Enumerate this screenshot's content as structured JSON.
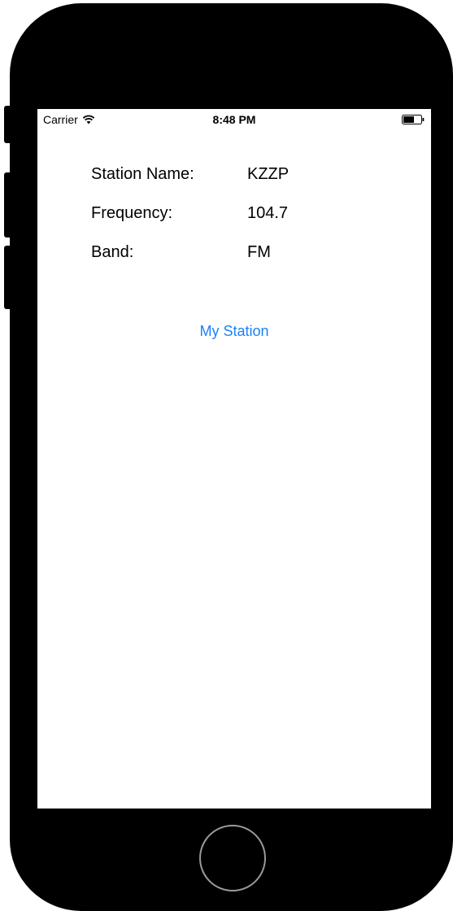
{
  "status_bar": {
    "carrier": "Carrier",
    "time": "8:48 PM",
    "wifi_icon": "wifi-icon",
    "battery_icon": "battery-icon"
  },
  "station": {
    "name_label": "Station Name:",
    "name_value": "KZZP",
    "frequency_label": "Frequency:",
    "frequency_value": "104.7",
    "band_label": "Band:",
    "band_value": "FM"
  },
  "button": {
    "label": "My Station",
    "color": "#1a82fb"
  },
  "device": {
    "frame_color": "#000000",
    "home_button": "home-button"
  }
}
